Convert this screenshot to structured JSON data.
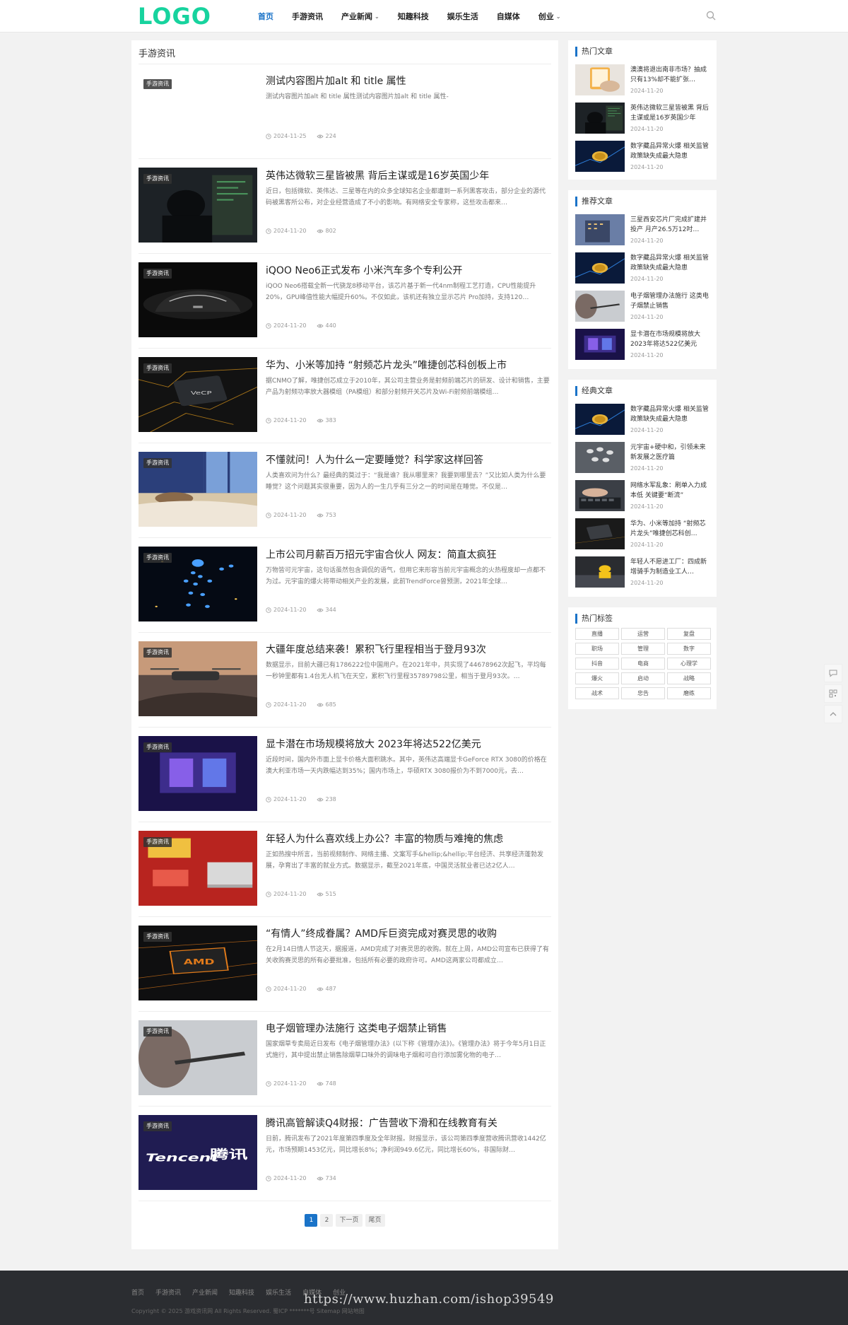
{
  "header": {
    "logo": "LOGO",
    "nav": [
      {
        "label": "首页",
        "active": true,
        "dropdown": false
      },
      {
        "label": "手游资讯",
        "active": false,
        "dropdown": false
      },
      {
        "label": "产业新闻",
        "active": false,
        "dropdown": true
      },
      {
        "label": "知趣科技",
        "active": false,
        "dropdown": false
      },
      {
        "label": "娱乐生活",
        "active": false,
        "dropdown": false
      },
      {
        "label": "自媒体",
        "active": false,
        "dropdown": false
      },
      {
        "label": "创业",
        "active": false,
        "dropdown": true
      }
    ],
    "search_icon": "search-icon"
  },
  "main": {
    "title": "手游资讯",
    "badge": "手游资讯",
    "articles": [
      {
        "title": "测试内容图片加alt 和 title 属性",
        "desc": "测试内容图片加alt 和 title 属性测试内容图片加alt 和 title 属性-",
        "date": "2024-11-25",
        "views": "224",
        "thumb": "none"
      },
      {
        "title": "英伟达微软三星皆被黑 背后主谋或是16岁英国少年",
        "desc": "近日，包括微软、英伟达、三星等在内的众多全球知名企业都遭到一系列黑客攻击，部分企业的源代码被黑客所公布，对企业经营造成了不小的影响。有网络安全专家称，这些攻击都来…",
        "date": "2024-11-20",
        "views": "802",
        "thumb": "hacker"
      },
      {
        "title": "iQOO Neo6正式发布 小米汽车多个专利公开",
        "desc": "iQOO Neo6搭载全新一代骁龙8移动平台，该芯片基于新一代4nm制程工艺打造，CPU性能提升20%，GPU峰值性能大幅提升60%。不仅如此，该机还有独立显示芯片 Pro加持，支持120…",
        "date": "2024-11-20",
        "views": "440",
        "thumb": "car"
      },
      {
        "title": "华为、小米等加持 “射频芯片龙头”唯捷创芯科创板上市",
        "desc": "据CNMO了解，唯捷创芯成立于2010年，其公司主营业务是射频前端芯片的研发、设计和销售，主要产品为射频功率放大器模组（PA模组）和部分射频开关芯片及Wi-Fi射频前端模组…",
        "date": "2024-11-20",
        "views": "383",
        "thumb": "chip"
      },
      {
        "title": "不懂就问！人为什么一定要睡觉？科学家这样回答",
        "desc": "人类喜欢问为什么？最经典的莫过于：“我是谁？我从哪里来？我要到哪里去？”又比如人类为什么要睡觉？这个问题其实很重要，因为人的一生几乎有三分之一的时间是在睡觉。不仅是…",
        "date": "2024-11-20",
        "views": "753",
        "thumb": "sleep"
      },
      {
        "title": "上市公司月薪百万招元宇宙合伙人 网友：简直太疯狂",
        "desc": "万物皆可元宇宙，这句话虽然包含调侃的语气，但用它来形容当前元宇宙概念的火热程度却一点都不为过。元宇宙的爆火将带动相关产业的发展，此前TrendForce曾预测，2021年全球…",
        "date": "2024-11-20",
        "views": "344",
        "thumb": "meta"
      },
      {
        "title": "大疆年度总结来袭！累积飞行里程相当于登月93次",
        "desc": "数据显示，目前大疆已有1786222位中国用户。在2021年中，共实现了44678962次起飞，平均每一秒钟里都有1.4台无人机飞在天空，累积飞行里程35789798公里，相当于登月93次。…",
        "date": "2024-11-20",
        "views": "685",
        "thumb": "drone"
      },
      {
        "title": "显卡潜在市场规模将放大 2023年将达522亿美元",
        "desc": "近段时间，国内外市面上显卡价格大面积跳水。其中，英伟达高端显卡GeForce RTX 3080的价格在澳大利亚市场一天内跌幅达到35%；国内市场上，华硕RTX 3080报价为不到7000元，去…",
        "date": "2024-11-20",
        "views": "238",
        "thumb": "gpu"
      },
      {
        "title": "年轻人为什么喜欢线上办公？丰富的物质与难掩的焦虑",
        "desc": "正如热搜中所言，当前视频制作、网络主播、文案写手&hellip;&hellip;平台经济、共享经济蓬勃发展，孕育出了丰富的就业方式。数据显示，截至2021年底，中国灵活就业者已达2亿人…",
        "date": "2024-11-20",
        "views": "515",
        "thumb": "office"
      },
      {
        "title": "“有情人”终成眷属？AMD斥巨资完成对赛灵思的收购",
        "desc": "在2月14日情人节这天，据报道，AMD完成了对赛灵思的收购。就在上周，AMD公司宣布已获得了有关收购赛灵思的所有必要批准，包括所有必要的政府许可。AMD这两家公司都成立…",
        "date": "2024-11-20",
        "views": "487",
        "thumb": "amd"
      },
      {
        "title": "电子烟管理办法施行 这类电子烟禁止销售",
        "desc": "国家烟草专卖局近日发布《电子烟管理办法》(以下称《管理办法》)。《管理办法》将于今年5月1日正式施行，其中提出禁止销售除烟草口味外的调味电子烟和可自行添加雾化物的电子…",
        "date": "2024-11-20",
        "views": "748",
        "thumb": "ecig"
      },
      {
        "title": "腾讯高管解读Q4财报：广告营收下滑和在线教育有关",
        "desc": "日前，腾讯发布了2021年度第四季度及全年财报。财报显示，该公司第四季度营收腾讯营收1442亿元，市场预期1453亿元，同比增长8%；净利润949.6亿元，同比增长60%，非国际财…",
        "date": "2024-11-20",
        "views": "734",
        "thumb": "tencent"
      }
    ],
    "pagination": [
      "1",
      "2",
      "下一页",
      "尾页"
    ]
  },
  "sidebar": {
    "hot": {
      "title": "热门文章",
      "items": [
        {
          "title": "澳澳将退出南非市场？抽成只有13%却不能扩张…",
          "date": "2024-11-20",
          "thumb": "phone"
        },
        {
          "title": "英伟达微软三星皆被黑 背后主谋或是16岁英国少年",
          "date": "2024-11-20",
          "thumb": "hacker"
        },
        {
          "title": "数字藏品异常火爆 相关监管政策缺失成最大隐患",
          "date": "2024-11-20",
          "thumb": "coin"
        }
      ]
    },
    "recommend": {
      "title": "推荐文章",
      "items": [
        {
          "title": "三星西安芯片厂完成扩建并投产 月产26.5万12吋…",
          "date": "2024-11-20",
          "thumb": "building"
        },
        {
          "title": "数字藏品异常火爆 相关监管政策缺失成最大隐患",
          "date": "2024-11-20",
          "thumb": "coin"
        },
        {
          "title": "电子烟管理办法施行 这类电子烟禁止销售",
          "date": "2024-11-20",
          "thumb": "ecig"
        },
        {
          "title": "显卡潜在市场规模将放大 2023年将达522亿美元",
          "date": "2024-11-20",
          "thumb": "gpu"
        }
      ]
    },
    "classic": {
      "title": "经典文章",
      "items": [
        {
          "title": "数字藏品异常火爆 相关监管政策缺失成最大隐患",
          "date": "2024-11-20",
          "thumb": "coin"
        },
        {
          "title": "元宇宙+硬中和，引领未来新发展之医疗篇",
          "date": "2024-11-20",
          "thumb": "meta-med"
        },
        {
          "title": "网络水军乱象：刷单入力成本低 关键要“断流”",
          "date": "2024-11-20",
          "thumb": "keyboard"
        },
        {
          "title": "华为、小米等加持 “射频芯片龙头”唯捷创芯科创…",
          "date": "2024-11-20",
          "thumb": "chip2"
        },
        {
          "title": "年轻人不愿进工厂：四成新增骑手为制造业工人…",
          "date": "2024-11-20",
          "thumb": "rider"
        }
      ]
    },
    "tags": {
      "title": "热门标签",
      "items": [
        "直播",
        "运营",
        "复盘",
        "职场",
        "管理",
        "数字",
        "抖音",
        "电商",
        "心理学",
        "爆火",
        "启动",
        "战略",
        "战术",
        "忠告",
        "磨练"
      ]
    }
  },
  "tools": [
    "comment-icon",
    "qrcode-icon",
    "back-to-top-icon"
  ],
  "footer": {
    "links": [
      "首页",
      "手游资讯",
      "产业新闻",
      "知趣科技",
      "娱乐生活",
      "自媒体",
      "创业"
    ],
    "copyright": "Copyright © 2025 游戏资讯网 All Rights Reserved.   蜀ICP *******号  Sitemap  网站地图",
    "watermark": "https://www.huzhan.com/ishop39549"
  },
  "colors": {
    "accent": "#1a73c8",
    "logo": "#17d39e",
    "footer_bg": "#2b2d31"
  }
}
